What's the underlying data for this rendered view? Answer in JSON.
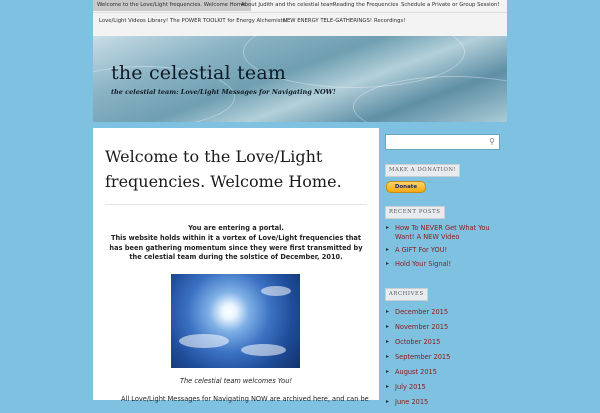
{
  "nav": {
    "items": [
      "Welcome to the Love/Light frequencies. Welcome Home.",
      "About Judith and the celestial team",
      "Reading the Frequencies",
      "Schedule a Private or Group Session!",
      "Love/Light Videos Library!",
      "The POWER TOOLKIT for Energy Alchemists!",
      "NEW ENERGY TELE-GATHERINGS!",
      "Recordings!"
    ]
  },
  "header": {
    "title": "the celestial team",
    "description": "the celestial team: Love/Light Messages for Navigating NOW!"
  },
  "post": {
    "title": "Welcome to the Love/Light frequencies. Welcome Home.",
    "line1": "You are entering a portal.",
    "line2": "This website holds within it a vortex of Love/Light frequencies that has been gathering momentum since they were first transmitted by the celestial team during the solstice of December, 2010.",
    "caption": "The celestial team welcomes You!",
    "more": "All Love/Light Messages for Navigating NOW are archived here, and can be"
  },
  "sidebar": {
    "search_icon": "search-icon",
    "donation_title": "MAKE A DONATION!",
    "donate_label": "Donate",
    "recent_title": "RECENT POSTS",
    "recent_posts": [
      "How To NEVER Get What You Want! A NEW Video",
      "A GIFT For YOU!",
      "Hold Your Signal!"
    ],
    "archives_title": "ARCHIVES",
    "archives": [
      "December 2015",
      "November 2015",
      "October 2015",
      "September 2015",
      "August 2015",
      "July 2015",
      "June 2015"
    ]
  },
  "colors": {
    "background": "#7fc1e0",
    "link": "#8b1a1a",
    "donate": "#f3a90f"
  }
}
